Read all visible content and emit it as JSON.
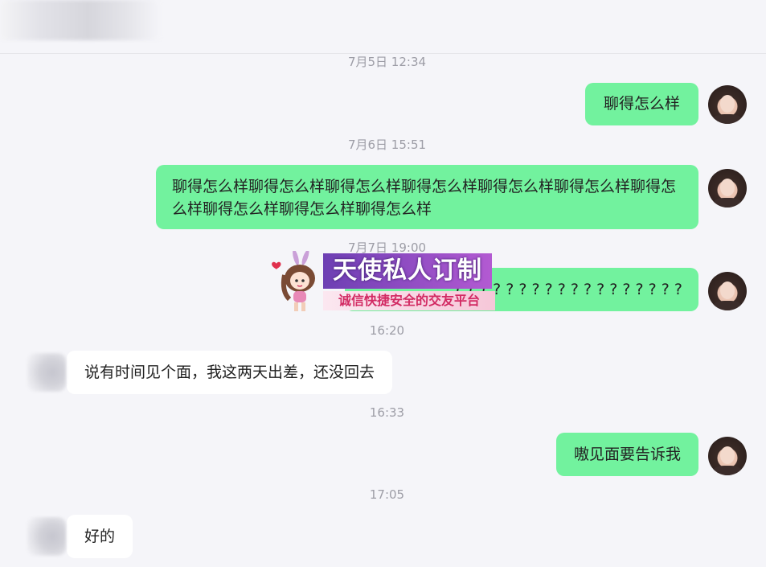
{
  "timestamps": [
    "7月5日 12:34",
    "7月6日 15:51",
    "7月7日 19:00",
    "16:20",
    "16:33",
    "17:05"
  ],
  "messages": [
    {
      "text": "聊得怎么样"
    },
    {
      "text": "聊得怎么样聊得怎么样聊得怎么样聊得怎么样聊得怎么样聊得怎么样聊得怎么样聊得怎么样聊得怎么样聊得怎么样"
    },
    {
      "text": "? ? ? ? ? ? ? ? ? ? ? ? ? ? ? ? ? ?"
    },
    {
      "text": "说有时间见个面，我这两天出差，还没回去"
    },
    {
      "text": "嗷见面要告诉我"
    },
    {
      "text": "好的"
    }
  ],
  "watermark": {
    "title": "天使私人订制",
    "subtitle": "诚信快捷安全的交友平台"
  },
  "colors": {
    "outgoing_bubble": "#72f29e",
    "incoming_bubble": "#ffffff",
    "background": "#f5f5f9",
    "timestamp_text": "#9d9da6"
  }
}
